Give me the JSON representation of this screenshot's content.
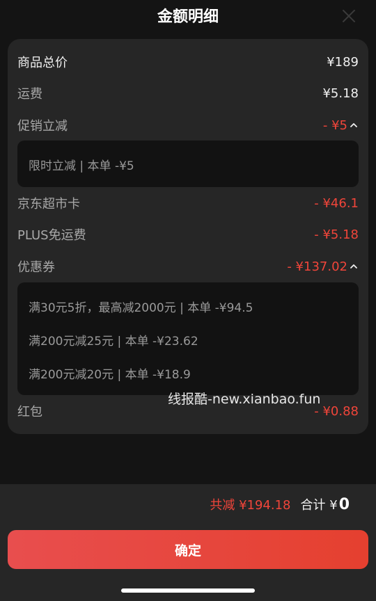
{
  "header": {
    "title": "金额明细"
  },
  "rows": {
    "goods_total": {
      "label": "商品总价",
      "value": "¥189"
    },
    "shipping": {
      "label": "运费",
      "value": "¥5.18"
    },
    "promo": {
      "label": "促销立减",
      "value": "- ¥5"
    },
    "jd_card": {
      "label": "京东超市卡",
      "value": "- ¥46.1"
    },
    "plus_free": {
      "label": "PLUS免运费",
      "value": "- ¥5.18"
    },
    "coupon": {
      "label": "优惠券",
      "value": "- ¥137.02"
    },
    "red_packet": {
      "label": "红包",
      "value": "- ¥0.88"
    }
  },
  "promo_details": [
    "限时立减 | 本单 -¥5"
  ],
  "coupon_details": [
    "满30元5折，最高减2000元 | 本单 -¥94.5",
    "满200元减25元 | 本单 -¥23.62",
    "满200元减20元 | 本单 -¥18.9"
  ],
  "watermark": "线报酷-new.xianbao.fun",
  "footer": {
    "total_reduce": "共减 ¥194.18",
    "sum_label": "合计 ¥",
    "sum_value": "0",
    "confirm_label": "确定"
  },
  "colors": {
    "accent": "#f0453a",
    "card": "#262626",
    "background": "#141414"
  },
  "icons": {
    "close": "close-icon",
    "expand": "chevron-up-icon"
  }
}
